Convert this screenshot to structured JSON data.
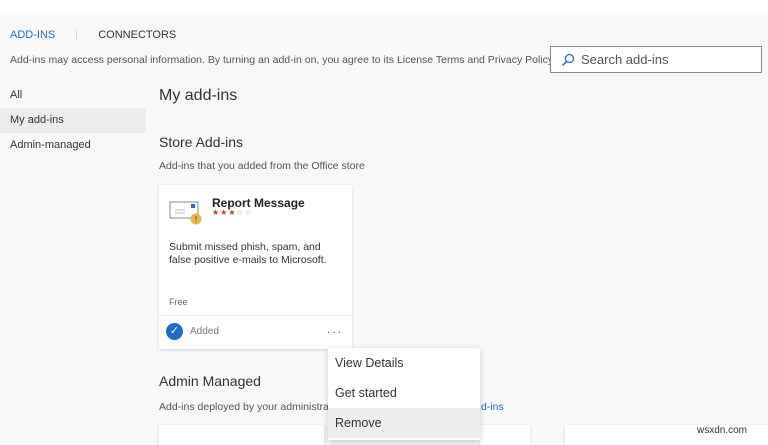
{
  "tabs": [
    {
      "label": "ADD-INS",
      "active": true
    },
    {
      "label": "CONNECTORS",
      "active": false
    }
  ],
  "notice": "Add-ins may access personal information. By turning an add-in on, you agree to its License Terms and Privacy Policy.",
  "search": {
    "placeholder": "Search add-ins"
  },
  "sidebar": {
    "items": [
      {
        "label": "All"
      },
      {
        "label": "My add-ins",
        "selected": true
      },
      {
        "label": "Admin-managed"
      }
    ]
  },
  "page_title": "My add-ins",
  "store": {
    "heading": "Store Add-ins",
    "subtitle": "Add-ins that you added from the Office store"
  },
  "card": {
    "title": "Report Message",
    "rating": 3,
    "max_rating": 5,
    "description": "Submit missed phish, spam, and false positive e-mails to Microsoft.",
    "price": "Free",
    "status": "Added",
    "more": "..."
  },
  "menu": {
    "items": [
      {
        "label": "View Details"
      },
      {
        "label": "Get started"
      },
      {
        "label": "Remove"
      }
    ]
  },
  "admin": {
    "heading": "Admin Managed",
    "subtitle": "Add-ins deployed by your administrat",
    "link_fragment": "d-ins"
  },
  "watermark": "wsxdn.com"
}
